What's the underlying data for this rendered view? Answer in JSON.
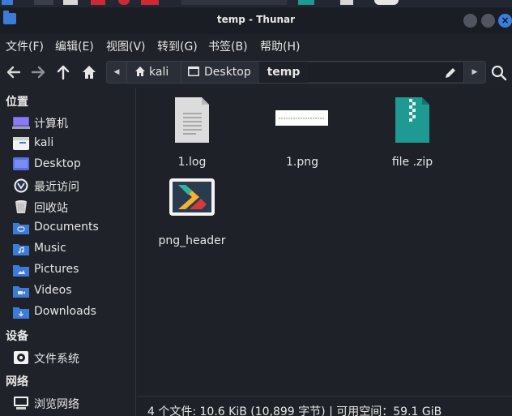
{
  "window": {
    "title": "temp - Thunar",
    "close_label": "×"
  },
  "menubar": {
    "items": [
      "文件(F)",
      "编辑(E)",
      "视图(V)",
      "转到(G)",
      "书签(B)",
      "帮助(H)"
    ]
  },
  "pathbar": {
    "segments": [
      "kali",
      "Desktop",
      "temp"
    ]
  },
  "sidebar": {
    "sections": [
      {
        "heading": "位置",
        "items": [
          "计算机",
          "kali",
          "Desktop",
          "最近访问",
          "回收站",
          "Documents",
          "Music",
          "Pictures",
          "Videos",
          "Downloads"
        ]
      },
      {
        "heading": "设备",
        "items": [
          "文件系统"
        ]
      },
      {
        "heading": "网络",
        "items": [
          "浏览网络"
        ]
      }
    ]
  },
  "files": [
    {
      "name": "1.log",
      "icon": "text-file-icon"
    },
    {
      "name": "1.png",
      "icon": "image-thumbnail-icon"
    },
    {
      "name": "file .zip",
      "icon": "zip-archive-icon"
    },
    {
      "name": "png_header",
      "icon": "executable-app-icon"
    }
  ],
  "statusbar": {
    "text": "4 个文件: 10.6 KiB (10,899 字节) | 可用空间：59.1 GiB"
  },
  "colors": {
    "accent": "#3d7bd9",
    "zip_teal": "#1e9a92",
    "background": "#1e2128"
  }
}
